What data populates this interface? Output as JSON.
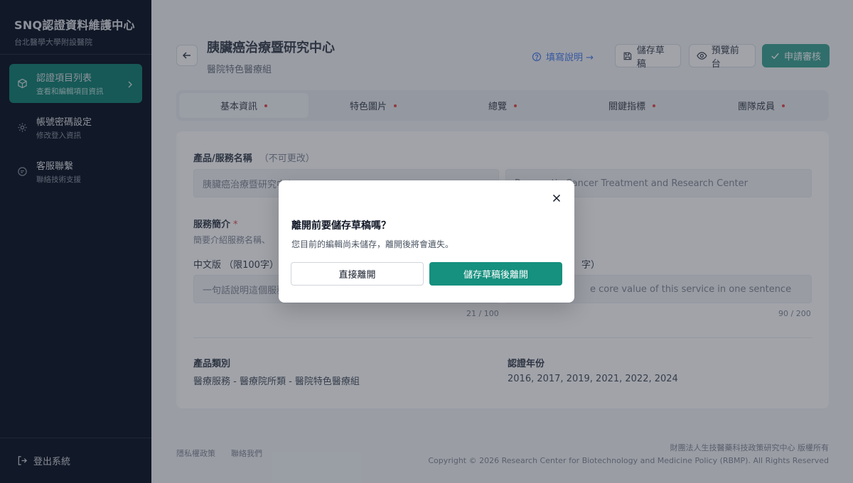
{
  "sidebar": {
    "brand_title": "SNQ認證資料維護中心",
    "brand_sub": "台北醫學大學附設醫院",
    "items": [
      {
        "label": "認證項目列表",
        "sub": "查看和編輯項目資訊",
        "icon": "cube-icon",
        "active": true
      },
      {
        "label": "帳號密碼設定",
        "sub": "修改登入資訊",
        "icon": "gear-icon",
        "active": false
      },
      {
        "label": "客服聯繫",
        "sub": "聯絡技術支援",
        "icon": "chat-icon",
        "active": false
      }
    ],
    "logout_label": "登出系統"
  },
  "header": {
    "title": "胰臟癌治療暨研究中心",
    "subtitle": "醫院特色醫療組",
    "help_label": "填寫說明 →",
    "save_draft_label": "儲存草稿",
    "preview_label": "預覽前台",
    "submit_label": "申請審核"
  },
  "tabs": [
    {
      "label": "基本資訊",
      "active": true
    },
    {
      "label": "特色圖片",
      "active": false
    },
    {
      "label": "總覽",
      "active": false
    },
    {
      "label": "關鍵指標",
      "active": false
    },
    {
      "label": "團隊成員",
      "active": false
    }
  ],
  "form": {
    "name_label": "產品/服務名稱",
    "name_note": "（不可更改）",
    "name_zh_value": "胰臟癌治療暨研究中心",
    "name_en_value": "Pancreatic Cancer Treatment and Research Center",
    "intro_label": "服務簡介",
    "intro_required": "*",
    "intro_hint": "簡要介紹服務名稱、",
    "zh_label": "中文版 （限100字）",
    "en_label": "字）",
    "zh_placeholder": "一句話說明這個服務",
    "en_placeholder": "e core value of this service in one sentence",
    "zh_counter": "21 / 100",
    "en_counter": "90 / 200",
    "category_label": "產品類別",
    "category_value": "醫療服務 - 醫療院所類 - 醫院特色醫療組",
    "year_label": "認證年份",
    "year_value": "2016, 2017, 2019, 2021, 2022, 2024"
  },
  "footer": {
    "privacy": "隱私權政策",
    "contact": "聯絡我們",
    "org": "財團法人生技醫藥科技政策研究中心 版權所有",
    "copyright": "Copyright © 2026 Research Center for Biotechnology and Medicine Policy (RBMP). All Rights Reserved"
  },
  "modal": {
    "title": "離開前要儲存草稿嗎？",
    "description": "您目前的編輯尚未儲存，離開後將會遺失。",
    "leave_label": "直接離開",
    "save_leave_label": "儲存草稿後離開"
  },
  "colors": {
    "accent": "#16907f",
    "sidebar_bg": "#111827",
    "required": "#dc2626",
    "link": "#2563eb"
  }
}
